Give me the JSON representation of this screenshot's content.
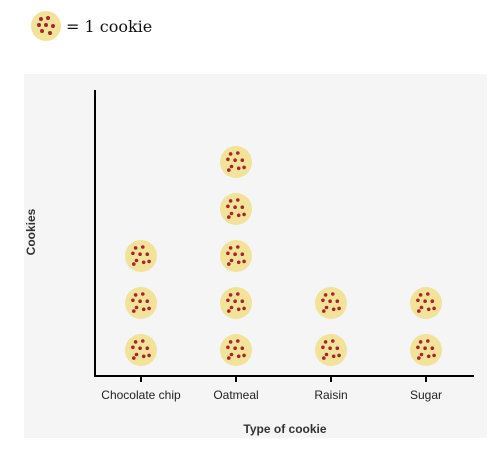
{
  "key": {
    "icon": "cookie-icon",
    "text": "= 1 cookie"
  },
  "chart_data": {
    "type": "pictograph",
    "xlabel": "Type of cookie",
    "ylabel": "Cookies",
    "categories": [
      "Chocolate chip",
      "Oatmeal",
      "Raisin",
      "Sugar"
    ],
    "values": [
      3,
      5,
      2,
      2
    ],
    "unit_per_icon": 1,
    "colors": {
      "cookie_fill": "#f3e29a",
      "cookie_dots": "#a3272b",
      "panel": "#f5f5f5",
      "axis": "#000000"
    }
  }
}
